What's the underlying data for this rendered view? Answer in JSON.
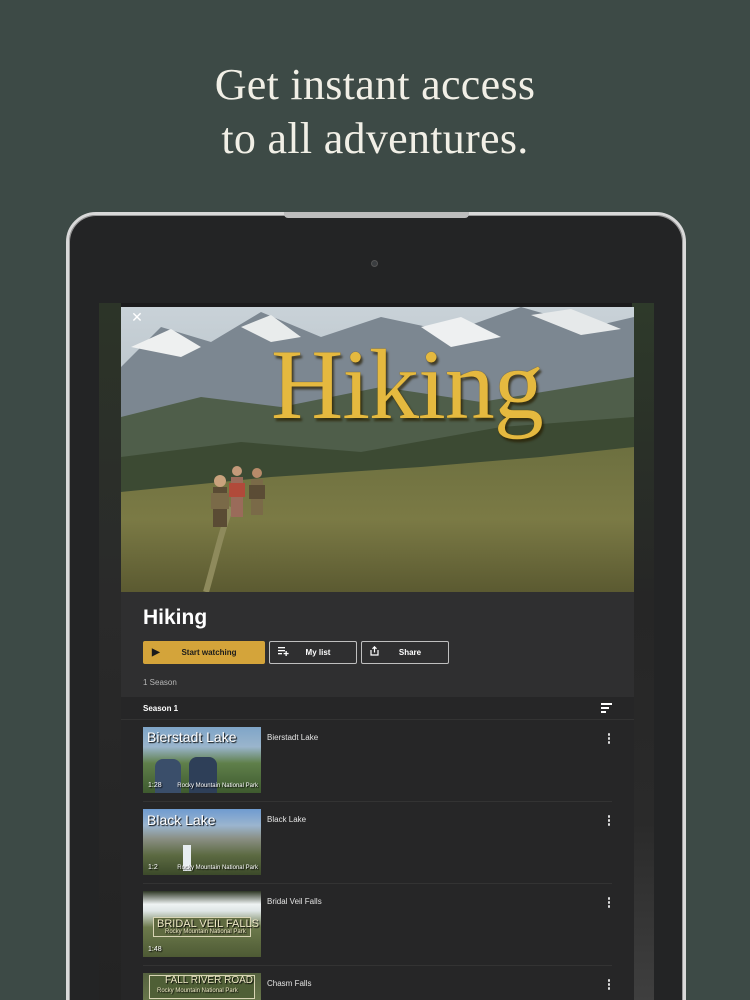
{
  "headline": {
    "line1": "Get instant access",
    "line2": "to all adventures."
  },
  "hero": {
    "title_art": "Hiking",
    "close_icon": "close-icon"
  },
  "show": {
    "title": "Hiking",
    "start_label": "Start watching",
    "mylist_label": "My list",
    "share_label": "Share",
    "season_count": "1 Season"
  },
  "season": {
    "label": "Season 1"
  },
  "episodes": [
    {
      "title": "Bierstadt Lake",
      "thumb_text": "Bierstadt Lake",
      "thumb_sub": "Rocky Mountain National Park",
      "time": "1:28"
    },
    {
      "title": "Black Lake",
      "thumb_text": "Black Lake",
      "thumb_sub": "Rocky Mountain National Park",
      "time": "1:2"
    },
    {
      "title": "Bridal Veil Falls",
      "thumb_text": "BRIDAL VEIL FALLS",
      "thumb_sub": "Rocky Mountain National Park",
      "time": "1:48"
    },
    {
      "title": "Chasm Falls",
      "thumb_text": "FALL RIVER ROAD",
      "thumb_sub": "Rocky Mountain National Park",
      "time": ""
    }
  ],
  "colors": {
    "background": "#3d4a46",
    "accent": "#d4a43a",
    "title_gold": "#e5b93f"
  }
}
